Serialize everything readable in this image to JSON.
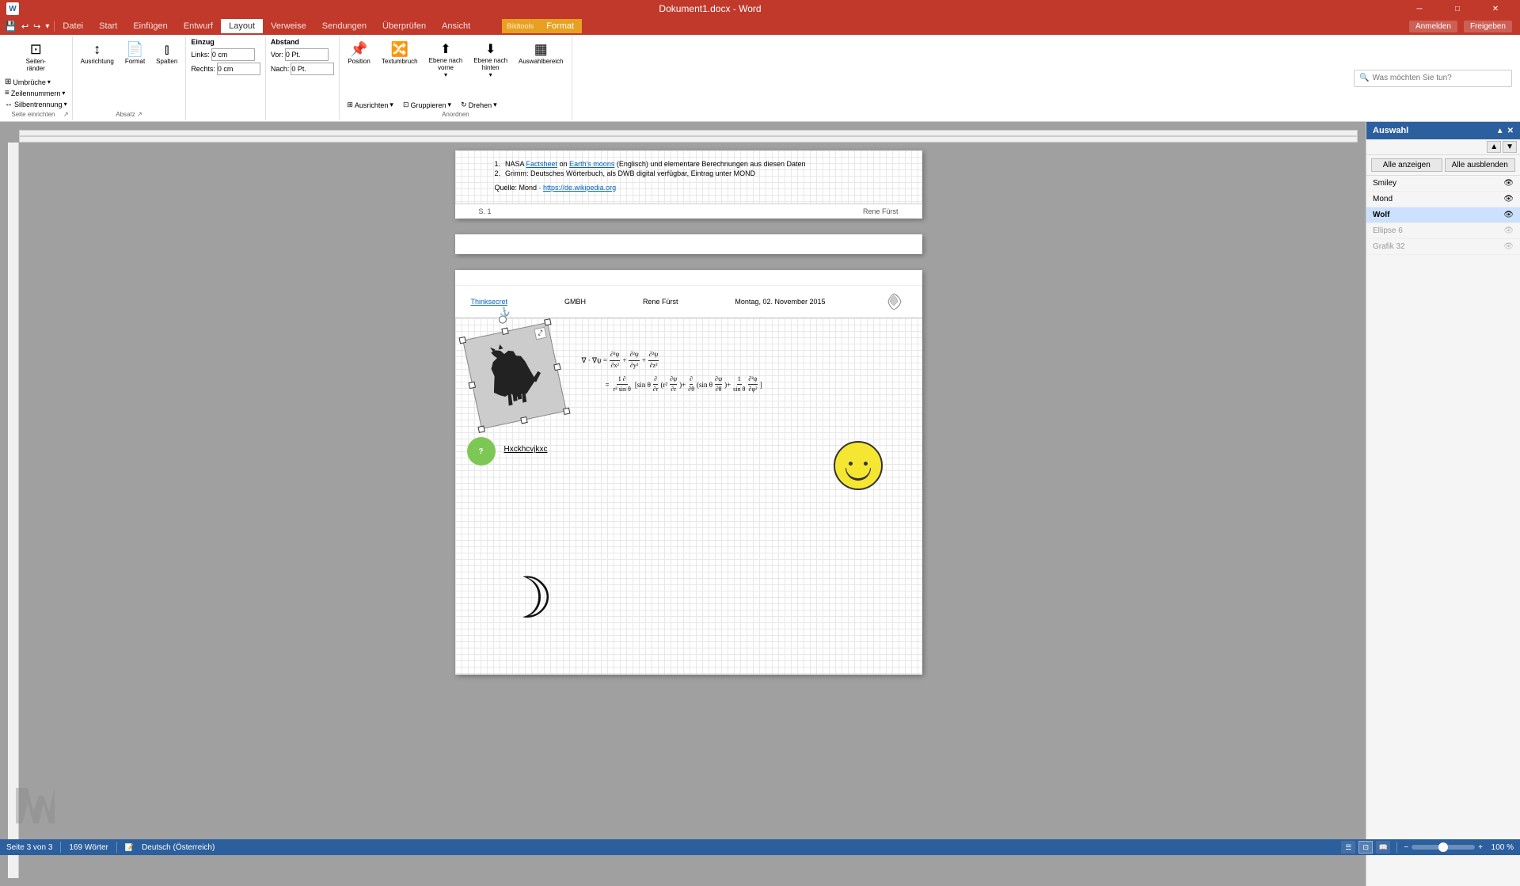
{
  "titleBar": {
    "appName": "Dokument1.docx - Word",
    "contextTab": "Bildtools",
    "btnMin": "─",
    "btnMax": "□",
    "btnClose": "✕"
  },
  "quickAccess": {
    "save": "💾",
    "undo": "↩",
    "redo": "↪",
    "more": "▾"
  },
  "ribbon": {
    "tabs": [
      "Datei",
      "Start",
      "Einfügen",
      "Entwurf",
      "Layout",
      "Verweise",
      "Sendungen",
      "Überprüfen",
      "Ansicht",
      "Format"
    ],
    "activeTab": "Layout",
    "contextTab": "Bildtools",
    "groups": {
      "seiteEinrichten": "Seite einrichten",
      "absatz": "Absatz",
      "anordnen": "Anordnen"
    },
    "buttons": {
      "umbrueche": "Umbrüche",
      "zeilennummern": "Zeilennummern",
      "silbentrennung": "Silbentrennung",
      "seiteRaender": "Seiten-\nränder",
      "ausrichtung": "Ausrichtung",
      "format": "Format",
      "spalten": "Spalten",
      "position": "Position",
      "textumbruch": "Textumbruch",
      "ebeneVorne": "Ebene nach\nvorne",
      "ebeneHinten": "Ebene nach\nhinten",
      "auswahlbereich": "Auswahlbereich",
      "ausrichten": "Ausrichten",
      "gruppieren": "Gruppieren",
      "drehen": "Drehen"
    },
    "inputs": {
      "links": "Links:",
      "rechts": "Rechts:",
      "vor": "Vor:",
      "nach": "Nach:",
      "linksVal": "0 cm",
      "rechtsVal": "0 cm",
      "vorVal": "0 Pt.",
      "nachVal": "0 Pt."
    },
    "search": {
      "placeholder": "Was möchten Sie tun?",
      "anmelden": "Anmelden",
      "freigeben": "Freigeben"
    }
  },
  "page1": {
    "listItems": [
      "NASA Factsheet on Earth's moons (Englisch) und elementare Berechnungen aus diesen Daten",
      "Grimm: Deutsches Wörterbuch, als DWB digital verfügbar, Eintrag unter MOND"
    ],
    "source": "Quelle: Mond · https://de.wikipedia.org",
    "sourceUrl": "https://de.wikipedia.org",
    "pageNum": "S. 1",
    "pageAuthor": "Rene Fürst"
  },
  "page2": {
    "header": {
      "company": "Thinksecret GMBH",
      "author": "Rene Fürst",
      "date": "Montag, 02. November 2015"
    },
    "hxcText": "Hxckhcvjkxc",
    "greenCircleNum": "?",
    "wolfLabel": "Wolf (selected)"
  },
  "selectionPanel": {
    "title": "Auswahl",
    "btnShowAll": "Alle anzeigen",
    "btnHideAll": "Alle ausblenden",
    "items": [
      {
        "label": "Smiley",
        "visible": true,
        "active": false
      },
      {
        "label": "Mond",
        "visible": true,
        "active": false
      },
      {
        "label": "Wolf",
        "visible": true,
        "active": true
      },
      {
        "label": "Ellipse 6",
        "visible": true,
        "active": false,
        "grayed": true
      },
      {
        "label": "Grafik 32",
        "visible": true,
        "active": false,
        "grayed": true
      }
    ]
  },
  "statusBar": {
    "page": "Seite 3 von 3",
    "words": "169 Wörter",
    "language": "Deutsch (Österreich)",
    "zoom": "100 %"
  }
}
